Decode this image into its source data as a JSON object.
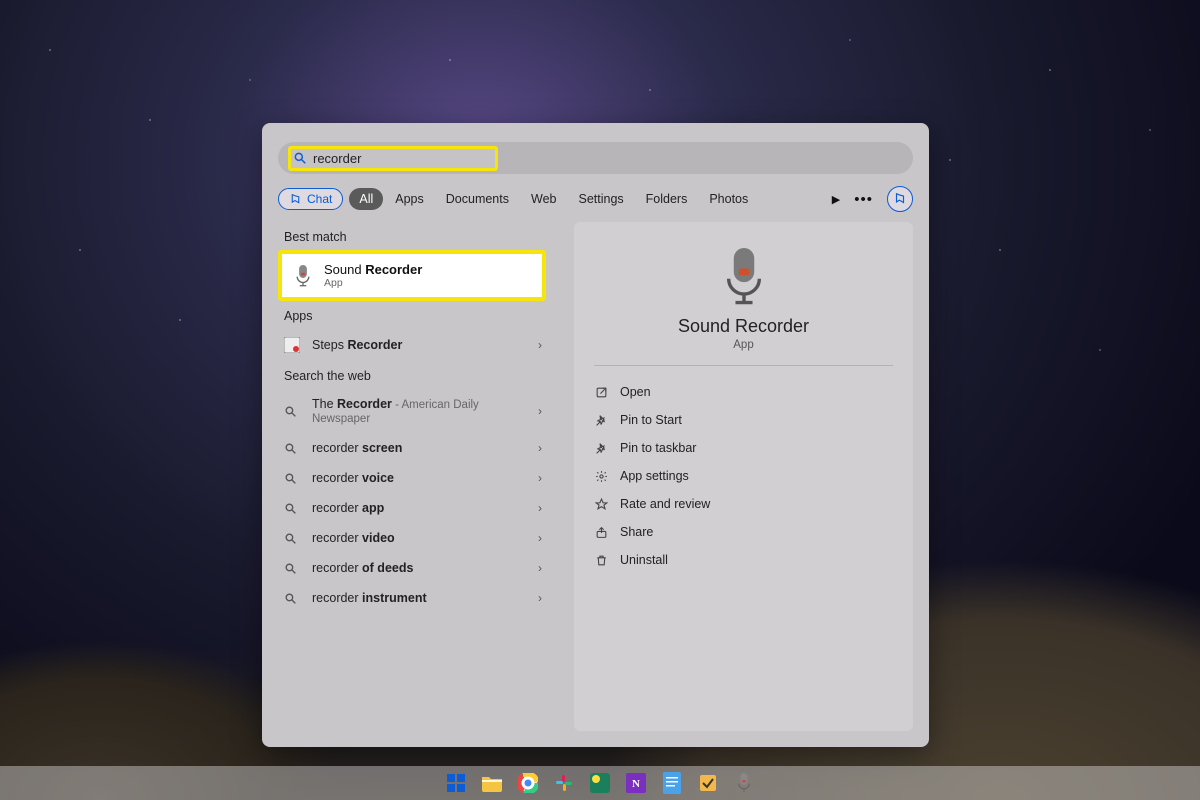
{
  "search": {
    "value": "recorder"
  },
  "tabs": {
    "chat": "Chat",
    "items": [
      "All",
      "Apps",
      "Documents",
      "Web",
      "Settings",
      "Folders",
      "Photos"
    ],
    "active_index": 0
  },
  "sections": {
    "best_match_label": "Best match",
    "apps_label": "Apps",
    "web_label": "Search the web"
  },
  "best_match": {
    "title_pre": "Sound ",
    "title_bold": "Recorder",
    "subtitle": "App"
  },
  "apps_list": [
    {
      "pre": "Steps ",
      "bold": "Recorder",
      "suffix": ""
    }
  ],
  "web_list": [
    {
      "pre": "The ",
      "bold": "Recorder",
      "suffix": " - American Daily Newspaper",
      "two_line": true
    },
    {
      "pre": "recorder ",
      "bold": "screen",
      "suffix": ""
    },
    {
      "pre": "recorder ",
      "bold": "voice",
      "suffix": ""
    },
    {
      "pre": "recorder ",
      "bold": "app",
      "suffix": ""
    },
    {
      "pre": "recorder ",
      "bold": "video",
      "suffix": ""
    },
    {
      "pre": "recorder ",
      "bold": "of deeds",
      "suffix": ""
    },
    {
      "pre": "recorder ",
      "bold": "instrument",
      "suffix": ""
    }
  ],
  "detail": {
    "title": "Sound Recorder",
    "subtitle": "App",
    "actions": [
      {
        "icon": "open",
        "label": "Open"
      },
      {
        "icon": "pin",
        "label": "Pin to Start"
      },
      {
        "icon": "pin",
        "label": "Pin to taskbar"
      },
      {
        "icon": "gear",
        "label": "App settings"
      },
      {
        "icon": "star",
        "label": "Rate and review"
      },
      {
        "icon": "share",
        "label": "Share"
      },
      {
        "icon": "trash",
        "label": "Uninstall"
      }
    ]
  },
  "taskbar": {
    "items": [
      "start",
      "explorer",
      "chrome",
      "slack",
      "pycharm",
      "onenote",
      "notepad",
      "snip",
      "sound-recorder"
    ]
  }
}
